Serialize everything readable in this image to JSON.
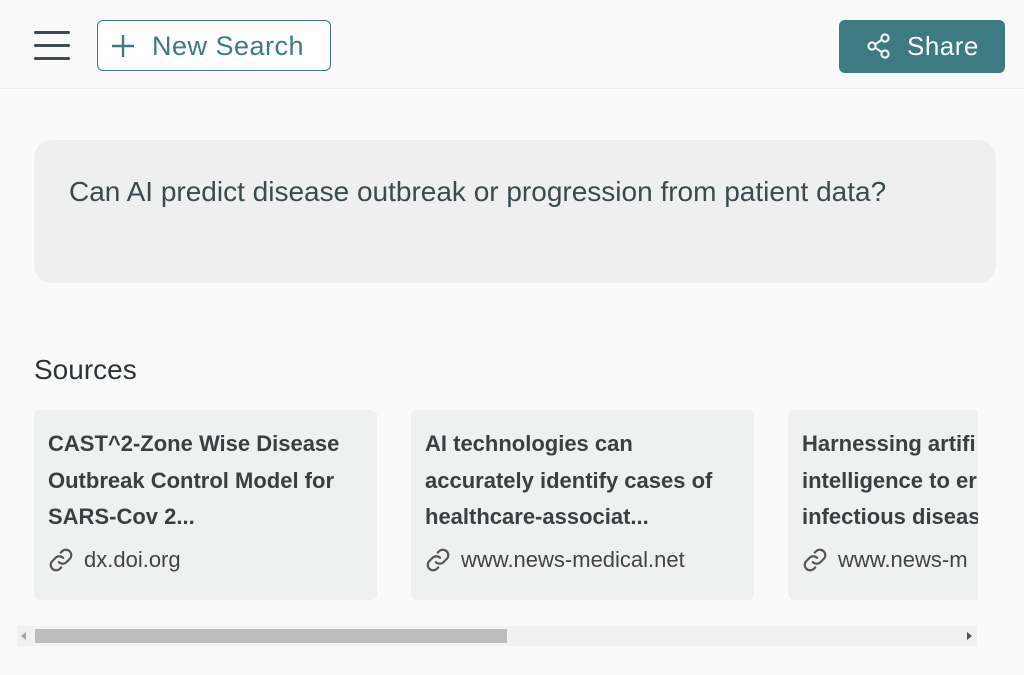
{
  "header": {
    "menu_icon": "hamburger-menu-icon",
    "new_search_label": "New Search",
    "new_search_icon": "plus-icon",
    "share_label": "Share",
    "share_icon": "share-nodes-icon",
    "accent_color": "#3e7a82"
  },
  "query": {
    "text": "Can AI predict disease outbreak or progression from patient data?"
  },
  "sources": {
    "title": "Sources",
    "link_icon": "link-icon",
    "items": [
      {
        "title": "CAST^2-Zone Wise Disease Outbreak Control Model for SARS-Cov 2...",
        "domain": "dx.doi.org"
      },
      {
        "title": "AI technologies can accurately identify cases of healthcare-associat...",
        "domain": "www.news-medical.net"
      },
      {
        "title": "Harnessing artifi intelligence to er infectious diseas",
        "domain": "www.news-m"
      }
    ]
  },
  "scrollbar": {
    "position_fraction": 0.0
  }
}
